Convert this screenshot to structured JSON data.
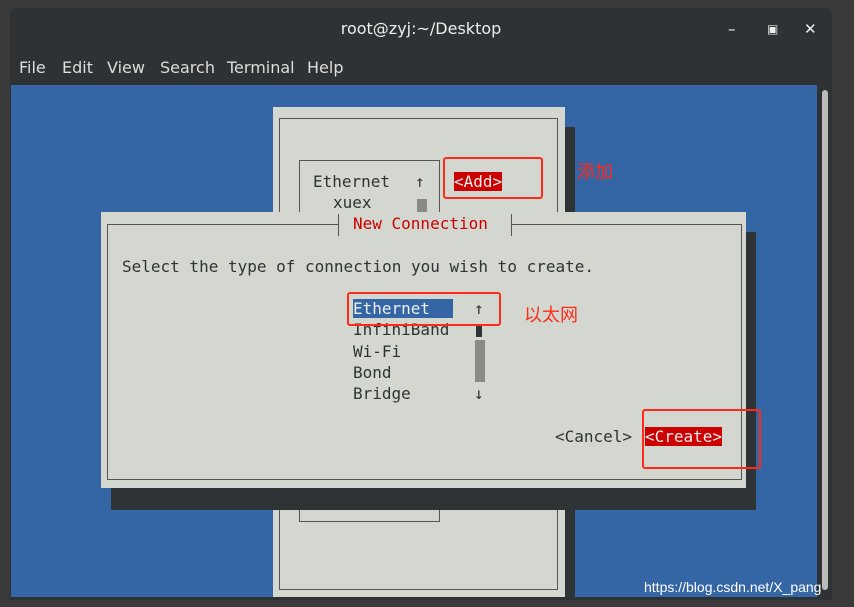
{
  "window": {
    "title": "root@zyj:~/Desktop",
    "buttons": [
      "minimize",
      "maximize",
      "close"
    ]
  },
  "menu": [
    "File",
    "Edit",
    "View",
    "Search",
    "Terminal",
    "Help"
  ],
  "back_dialog": {
    "list": [
      "Ethernet",
      "xuex"
    ],
    "add_button": "<Add>",
    "annotation": "添加"
  },
  "dialog": {
    "title": "New Connection",
    "prompt": "Select the type of connection you wish to create.",
    "options": [
      "Ethernet",
      "InfiniBand",
      "Wi-Fi",
      "Bond",
      "Bridge"
    ],
    "selected": "Ethernet",
    "cancel": "<Cancel>",
    "create": "<Create>",
    "annotation": "以太网"
  },
  "watermark": "https://blog.csdn.net/X_pang",
  "colors": {
    "terminal_bg": "#3465a4",
    "dialog_bg": "#d3d7cf",
    "accent_red": "#cc0000",
    "annotation": "#ff2a1a"
  }
}
